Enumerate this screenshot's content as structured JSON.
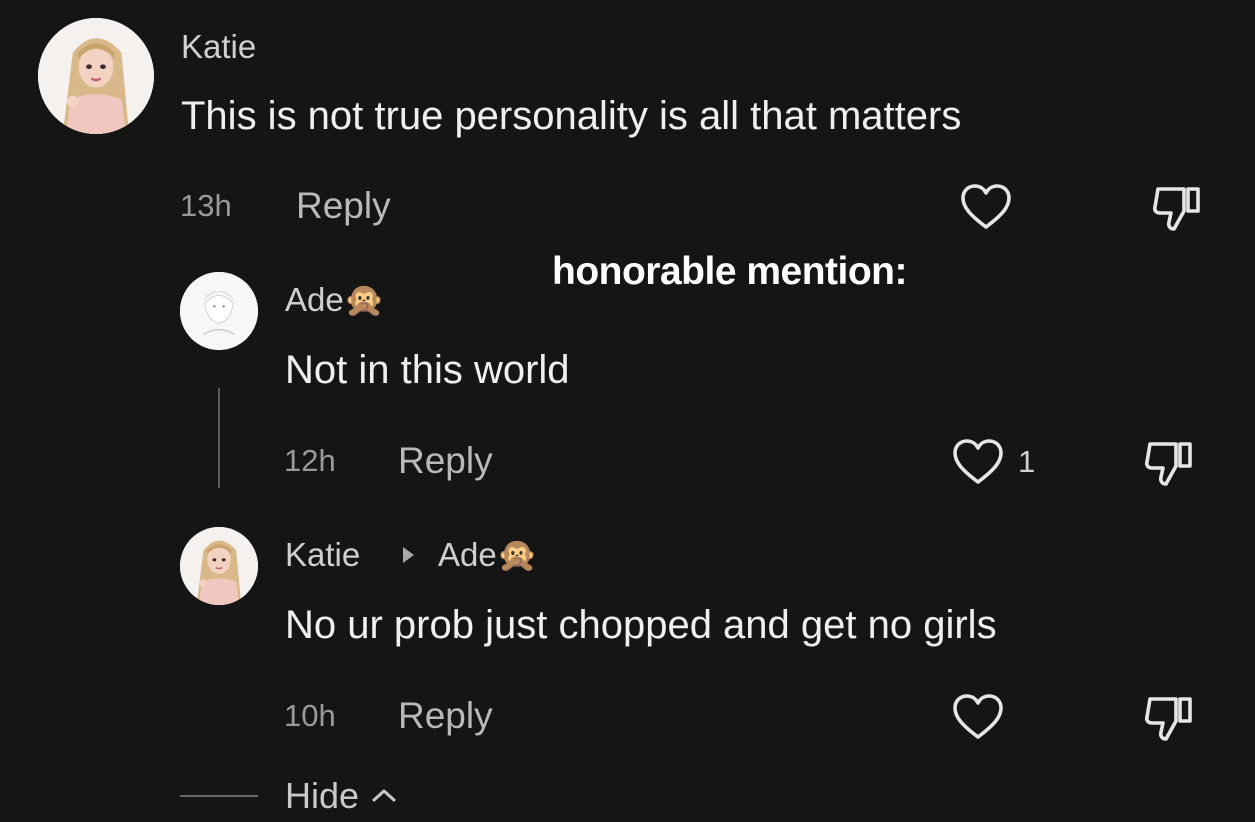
{
  "overlay_caption": "honorable mention:",
  "comments": [
    {
      "author": "Katie",
      "text": "This is not true personality is all that matters",
      "time": "13h",
      "reply_label": "Reply",
      "likes": ""
    },
    {
      "author": "Ade",
      "author_emoji": "🙊",
      "text": "Not in this world",
      "time": "12h",
      "reply_label": "Reply",
      "likes": "1"
    },
    {
      "author": "Katie",
      "reply_to": "Ade",
      "reply_to_emoji": "🙊",
      "text": "No ur prob just chopped and get no girls",
      "time": "10h",
      "reply_label": "Reply",
      "likes": ""
    }
  ],
  "hide_label": "Hide",
  "icons": {
    "like": "heart-outline-icon",
    "dislike": "thumbs-down-outline-icon",
    "collapse": "chevron-up-icon",
    "reply_arrow": "triangle-right-icon"
  },
  "colors": {
    "background": "#151515",
    "text": "#f0f0f0",
    "muted": "#9a9a9a"
  }
}
